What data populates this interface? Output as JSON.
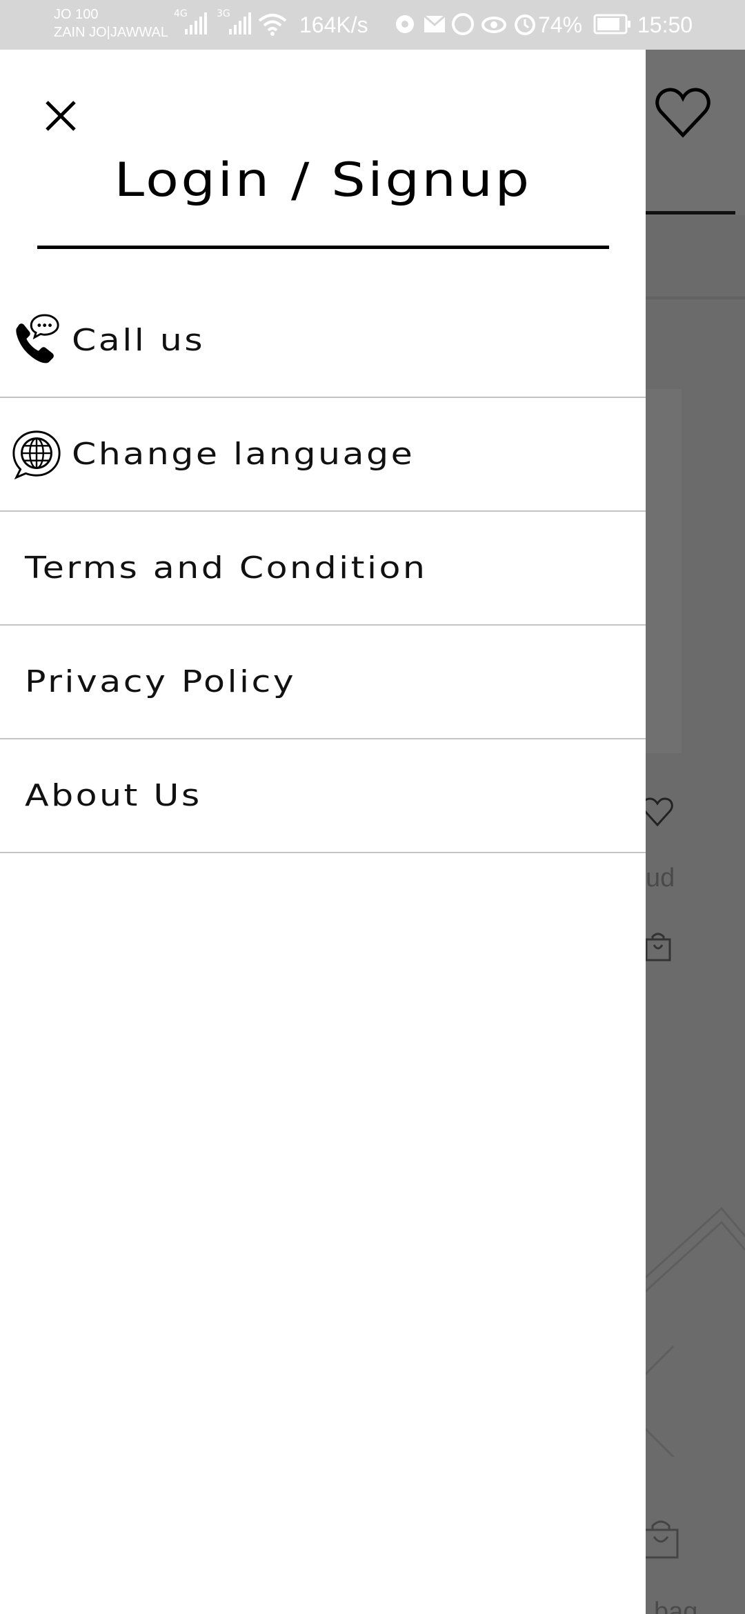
{
  "status_bar": {
    "carrier_line1": "JO 100",
    "carrier_line2": "ZAIN JO|JAWWAL",
    "net1": "4G",
    "net2": "3G",
    "speed": "164K/s",
    "battery": "74%",
    "time": "15:50"
  },
  "drawer": {
    "title": "Login / Signup",
    "close_icon": "close-icon",
    "items": [
      {
        "label": "Call us",
        "icon": "phone-chat-icon"
      },
      {
        "label": "Change language",
        "icon": "globe-chat-icon"
      },
      {
        "label": "Terms and Condition"
      },
      {
        "label": "Privacy Policy"
      },
      {
        "label": "About Us"
      }
    ]
  },
  "background": {
    "partial_text_1": "ud",
    "partial_text_2": "bag"
  }
}
